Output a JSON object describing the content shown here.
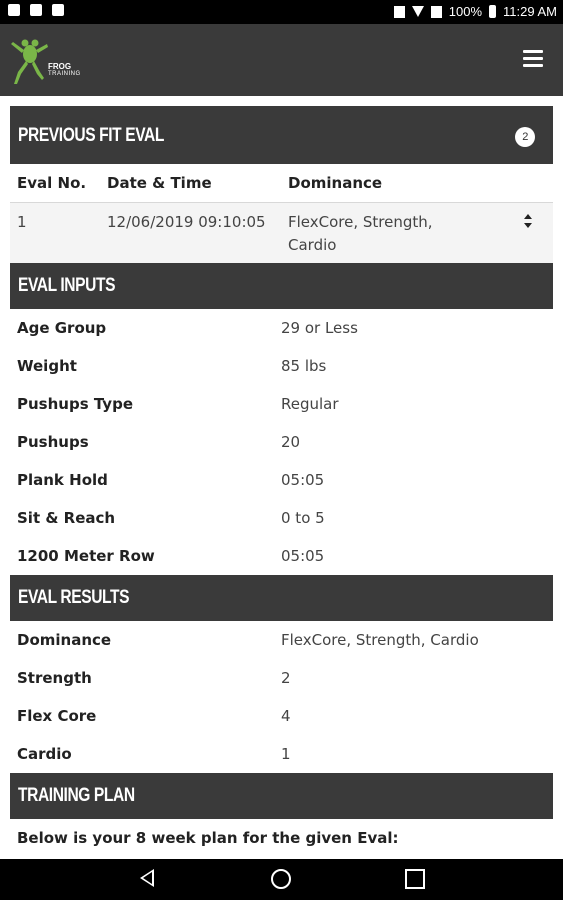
{
  "status_bar": {
    "battery": "100%",
    "time": "11:29 AM"
  },
  "app": {
    "logo_line1": "FROG",
    "logo_line2": "TRAINING"
  },
  "previous_fit_eval": {
    "title": "PREVIOUS FIT EVAL",
    "count": "2",
    "columns": [
      "Eval No.",
      "Date & Time",
      "Dominance"
    ],
    "rows": [
      {
        "eval_no": "1",
        "date_time": "12/06/2019 09:10:05",
        "dominance_line1": "FlexCore, Strength,",
        "dominance_line2": "Cardio"
      }
    ]
  },
  "eval_inputs": {
    "title": "EVAL INPUTS",
    "items": [
      {
        "label": "Age Group",
        "value": "29 or Less"
      },
      {
        "label": "Weight",
        "value": "85 lbs"
      },
      {
        "label": "Pushups Type",
        "value": "Regular"
      },
      {
        "label": "Pushups",
        "value": "20"
      },
      {
        "label": "Plank Hold",
        "value": "05:05"
      },
      {
        "label": "Sit & Reach",
        "value": "0 to 5"
      },
      {
        "label": "1200 Meter Row",
        "value": "05:05"
      }
    ]
  },
  "eval_results": {
    "title": "EVAL RESULTS",
    "items": [
      {
        "label": "Dominance",
        "value": "FlexCore, Strength, Cardio"
      },
      {
        "label": "Strength",
        "value": "2"
      },
      {
        "label": "Flex Core",
        "value": "4"
      },
      {
        "label": "Cardio",
        "value": "1"
      }
    ]
  },
  "training_plan": {
    "title": "TRAINING PLAN",
    "text": "Below is your 8 week plan for the given Eval:"
  },
  "colors": {
    "header_bg": "#3a3a3a",
    "logo_green": "#7ab648"
  }
}
